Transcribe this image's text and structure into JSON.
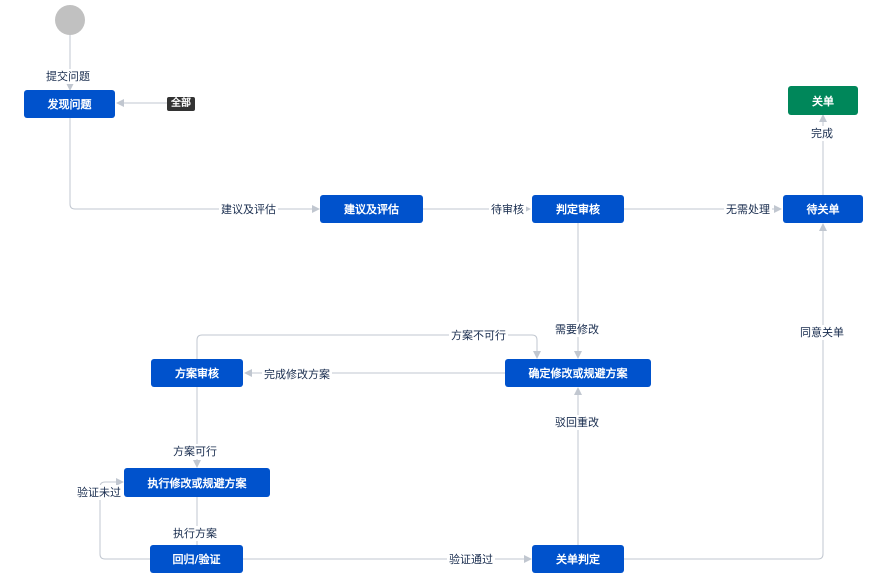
{
  "nodes": {
    "discover": "发现问题",
    "suggest": "建议及评估",
    "judge": "判定审核",
    "pending_close": "待关单",
    "closed": "关单",
    "fix_plan": "确定修改或规避方案",
    "plan_review": "方案审核",
    "execute": "执行修改或规避方案",
    "regression": "回归/验证",
    "close_judge": "关单判定"
  },
  "transitions": {
    "submit": "提交问题",
    "all": "全部",
    "suggest_eval": "建议及评估",
    "to_review": "待审核",
    "no_handling": "无需处理",
    "complete": "完成",
    "need_modify": "需要修改",
    "agree_close": "同意关单",
    "plan_infeasible": "方案不可行",
    "finish_plan": "完成修改方案",
    "plan_feasible": "方案可行",
    "reject_redo": "驳回重改",
    "verify_failed": "验证未过",
    "execute_plan": "执行方案",
    "verify_passed": "验证通过"
  },
  "colors": {
    "status_blue": "#0052cc",
    "status_done": "#00875a",
    "line": "#c1c7d0",
    "start": "#c1c1c1"
  }
}
